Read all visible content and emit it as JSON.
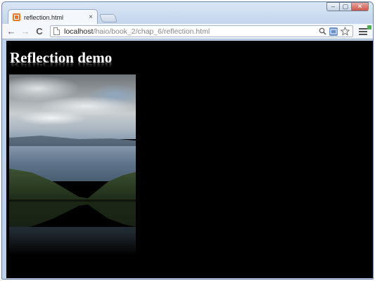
{
  "tab": {
    "title": "reflection.html",
    "close_glyph": "×"
  },
  "toolbar": {
    "back_glyph": "←",
    "forward_glyph": "→",
    "reload_glyph": "C"
  },
  "address_bar": {
    "host": "localhost",
    "path": "/haio/book_2/chap_6/reflection.html",
    "icons": [
      "page-icon",
      "search-icon",
      "translate-icon",
      "star-icon",
      "menu-icon"
    ]
  },
  "window_controls": {
    "minimize_glyph": "–",
    "maximize_glyph": "▢",
    "close_glyph": "✕"
  },
  "page": {
    "heading": "Reflection demo",
    "image": "lake landscape photo with reflection"
  },
  "colors": {
    "page_background": "#000000",
    "heading_text": "#ffffff",
    "favicon": "#e8792a"
  }
}
